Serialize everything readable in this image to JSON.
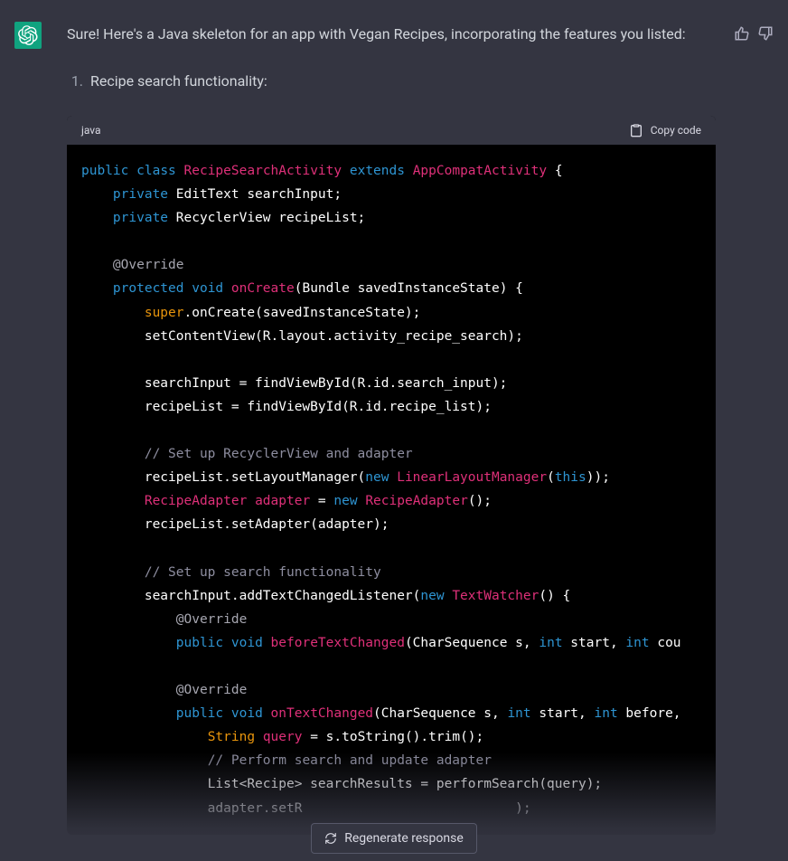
{
  "assistant": {
    "intro": "Sure! Here's a Java skeleton for an app with Vegan Recipes, incorporating the features you listed:",
    "list_item_1": "Recipe search functionality:"
  },
  "codeblock": {
    "language": "java",
    "copy_label": "Copy code",
    "tokens": [
      [
        [
          "kw",
          "public"
        ],
        [
          "sp",
          " "
        ],
        [
          "kw",
          "class"
        ],
        [
          "sp",
          " "
        ],
        [
          "cls",
          "RecipeSearchActivity"
        ],
        [
          "sp",
          " "
        ],
        [
          "kw",
          "extends"
        ],
        [
          "sp",
          " "
        ],
        [
          "cls",
          "AppCompatActivity"
        ],
        [
          "pl",
          " {"
        ]
      ],
      [
        [
          "sp",
          "    "
        ],
        [
          "kw",
          "private"
        ],
        [
          "pl",
          " EditText searchInput;"
        ]
      ],
      [
        [
          "sp",
          "    "
        ],
        [
          "kw",
          "private"
        ],
        [
          "pl",
          " RecyclerView recipeList;"
        ]
      ],
      [],
      [
        [
          "sp",
          "    "
        ],
        [
          "ann",
          "@Override"
        ]
      ],
      [
        [
          "sp",
          "    "
        ],
        [
          "kw",
          "protected"
        ],
        [
          "sp",
          " "
        ],
        [
          "kw",
          "void"
        ],
        [
          "sp",
          " "
        ],
        [
          "fn",
          "onCreate"
        ],
        [
          "pl",
          "(Bundle savedInstanceState) {"
        ]
      ],
      [
        [
          "sp",
          "        "
        ],
        [
          "sup",
          "super"
        ],
        [
          "pl",
          ".onCreate(savedInstanceState);"
        ]
      ],
      [
        [
          "sp",
          "        "
        ],
        [
          "pl",
          "setContentView(R.layout.activity_recipe_search);"
        ]
      ],
      [],
      [
        [
          "sp",
          "        "
        ],
        [
          "pl",
          "searchInput = findViewById(R.id.search_input);"
        ]
      ],
      [
        [
          "sp",
          "        "
        ],
        [
          "pl",
          "recipeList = findViewById(R.id.recipe_list);"
        ]
      ],
      [],
      [
        [
          "sp",
          "        "
        ],
        [
          "cmt",
          "// Set up RecyclerView and adapter"
        ]
      ],
      [
        [
          "sp",
          "        "
        ],
        [
          "pl",
          "recipeList.setLayoutManager("
        ],
        [
          "kw",
          "new"
        ],
        [
          "sp",
          " "
        ],
        [
          "cls",
          "LinearLayoutManager"
        ],
        [
          "pl",
          "("
        ],
        [
          "kw",
          "this"
        ],
        [
          "pl",
          "));"
        ]
      ],
      [
        [
          "sp",
          "        "
        ],
        [
          "cls",
          "RecipeAdapter"
        ],
        [
          "sp",
          " "
        ],
        [
          "var",
          "adapter"
        ],
        [
          "pl",
          " = "
        ],
        [
          "kw",
          "new"
        ],
        [
          "sp",
          " "
        ],
        [
          "cls",
          "RecipeAdapter"
        ],
        [
          "pl",
          "();"
        ]
      ],
      [
        [
          "sp",
          "        "
        ],
        [
          "pl",
          "recipeList.setAdapter(adapter);"
        ]
      ],
      [],
      [
        [
          "sp",
          "        "
        ],
        [
          "cmt",
          "// Set up search functionality"
        ]
      ],
      [
        [
          "sp",
          "        "
        ],
        [
          "pl",
          "searchInput.addTextChangedListener("
        ],
        [
          "kw",
          "new"
        ],
        [
          "sp",
          " "
        ],
        [
          "cls",
          "TextWatcher"
        ],
        [
          "pl",
          "() {"
        ]
      ],
      [
        [
          "sp",
          "            "
        ],
        [
          "ann",
          "@Override"
        ]
      ],
      [
        [
          "sp",
          "            "
        ],
        [
          "kw",
          "public"
        ],
        [
          "sp",
          " "
        ],
        [
          "kw",
          "void"
        ],
        [
          "sp",
          " "
        ],
        [
          "fn",
          "beforeTextChanged"
        ],
        [
          "pl",
          "(CharSequence s, "
        ],
        [
          "kw",
          "int"
        ],
        [
          "pl",
          " start, "
        ],
        [
          "kw",
          "int"
        ],
        [
          "pl",
          " cou"
        ]
      ],
      [],
      [
        [
          "sp",
          "            "
        ],
        [
          "ann",
          "@Override"
        ]
      ],
      [
        [
          "sp",
          "            "
        ],
        [
          "kw",
          "public"
        ],
        [
          "sp",
          " "
        ],
        [
          "kw",
          "void"
        ],
        [
          "sp",
          " "
        ],
        [
          "fn",
          "onTextChanged"
        ],
        [
          "pl",
          "(CharSequence s, "
        ],
        [
          "kw",
          "int"
        ],
        [
          "pl",
          " start, "
        ],
        [
          "kw",
          "int"
        ],
        [
          "pl",
          " before,"
        ]
      ],
      [
        [
          "sp",
          "                "
        ],
        [
          "type",
          "String"
        ],
        [
          "sp",
          " "
        ],
        [
          "var",
          "query"
        ],
        [
          "pl",
          " = s.toString().trim();"
        ]
      ],
      [
        [
          "sp",
          "                "
        ],
        [
          "cmt",
          "// Perform search and update adapter"
        ]
      ],
      [
        [
          "sp",
          "                "
        ],
        [
          "pl",
          "List<Recipe> searchResults = performSearch(query);"
        ]
      ],
      [
        [
          "sp",
          "                "
        ],
        [
          "pl",
          "adapter.setR                           );"
        ]
      ]
    ]
  },
  "actions": {
    "regenerate": "Regenerate response"
  }
}
